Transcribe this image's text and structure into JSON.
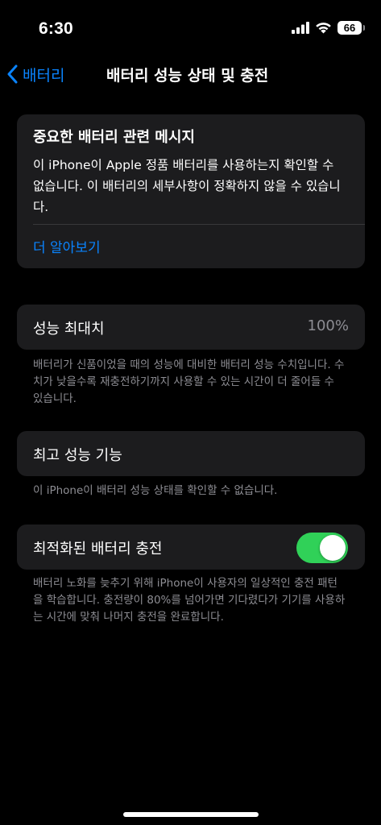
{
  "status_bar": {
    "time": "6:30",
    "battery_level": "66",
    "signal_icon": "cellular-signal-icon",
    "wifi_icon": "wifi-icon"
  },
  "nav": {
    "back_label": "배터리",
    "title": "배터리 성능 상태 및 충전"
  },
  "alert": {
    "title": "중요한 배터리 관련 메시지",
    "body": "이 iPhone이 Apple 정품 배터리를 사용하는지 확인할 수 없습니다. 이 배터리의 세부사항이 정확하지 않을 수 있습니다.",
    "link": "더 알아보기"
  },
  "peak_capacity": {
    "label": "성능 최대치",
    "value": "100%",
    "footnote": "배터리가 신품이었을 때의 성능에 대비한 배터리 성능 수치입니다. 수치가 낮을수록 재충전하기까지 사용할 수 있는 시간이 더 줄어들 수 있습니다."
  },
  "peak_performance": {
    "label": "최고 성능 기능",
    "footnote": "이 iPhone이 배터리 성능 상태를 확인할 수 없습니다."
  },
  "optimized_charging": {
    "label": "최적화된 배터리 충전",
    "enabled": true,
    "footnote": "배터리 노화를 늦추기 위해 iPhone이 사용자의 일상적인 충전 패턴을 학습합니다. 충전량이 80%를 넘어가면 기다렸다가 기기를 사용하는 시간에 맞춰 나머지 충전을 완료합니다."
  },
  "colors": {
    "background": "#000000",
    "card": "#1c1c1e",
    "accent_blue": "#0a84ff",
    "toggle_on": "#30d158",
    "secondary_text": "#8d8d93"
  }
}
